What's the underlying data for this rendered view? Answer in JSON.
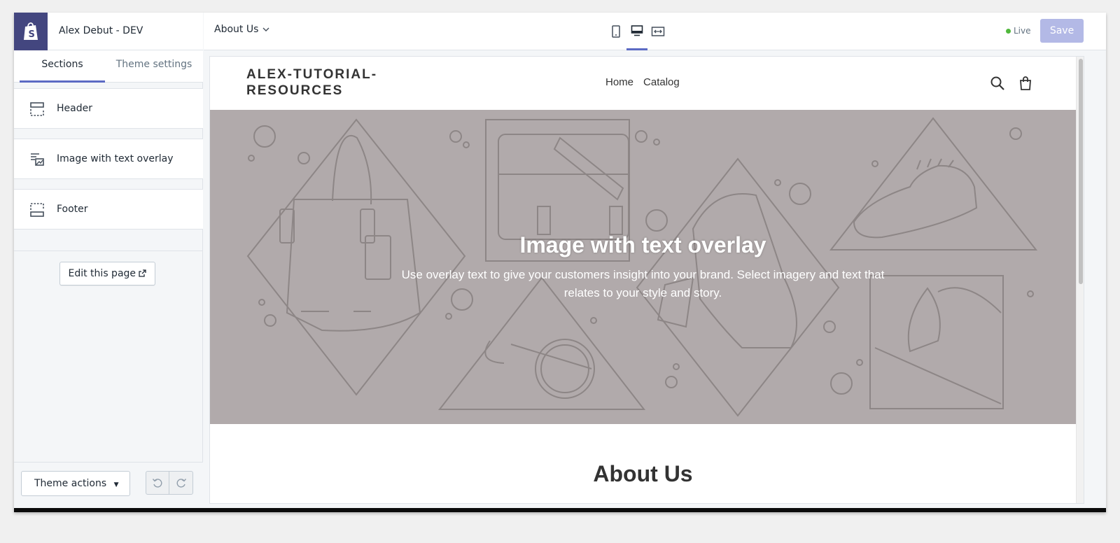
{
  "sidebar": {
    "store_name": "Alex Debut - DEV",
    "tabs": [
      {
        "label": "Sections",
        "active": true
      },
      {
        "label": "Theme settings",
        "active": false
      }
    ],
    "sections": [
      {
        "label": "Header",
        "icon": "header-layout-icon"
      },
      {
        "label": "Image with text overlay",
        "icon": "image-text-icon"
      },
      {
        "label": "Footer",
        "icon": "footer-layout-icon"
      }
    ],
    "edit_page_label": "Edit this page",
    "theme_actions_label": "Theme actions"
  },
  "topbar": {
    "page_selector": "About Us",
    "devices": [
      "mobile-icon",
      "desktop-icon",
      "fullscreen-icon"
    ],
    "active_device": "desktop",
    "live_label": "Live",
    "save_label": "Save",
    "accent_color": "#5c6ac4"
  },
  "preview": {
    "logo_line1": "ALEX-TUTORIAL-",
    "logo_line2": "RESOURCES",
    "nav": [
      "Home",
      "Catalog"
    ],
    "hero": {
      "title": "Image with text overlay",
      "text": "Use overlay text to give your customers insight into your brand. Select imagery and text that relates to your style and story."
    },
    "about_title": "About Us"
  }
}
